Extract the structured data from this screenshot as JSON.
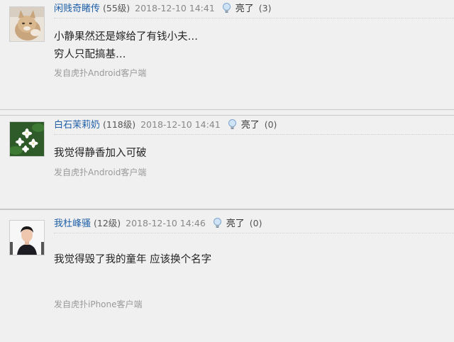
{
  "posts": [
    {
      "username": "闲贱奇睹传",
      "level": "(55级)",
      "time": "2018-12-10 14:41",
      "light_label": "亮了",
      "light_count": "(3)",
      "content_lines": [
        "小静果然还是嫁给了有钱小夫…",
        "穷人只配搞基…"
      ],
      "source": "发自虎扑Android客户端",
      "avatar_icon": "cat-avatar"
    },
    {
      "username": "白石茉莉奶",
      "level": "(118级)",
      "time": "2018-12-10 14:41",
      "light_label": "亮了",
      "light_count": "(0)",
      "content_lines": [
        "我觉得静香加入可破"
      ],
      "source": "发自虎扑Android客户端",
      "avatar_icon": "jasmine-flower-avatar"
    },
    {
      "username": "我杜峰骚",
      "level": "(12级)",
      "time": "2018-12-10 14:46",
      "light_label": "亮了",
      "light_count": "(0)",
      "content_lines": [
        "我觉得毁了我的童年 应该换个名字"
      ],
      "source": "发自虎扑iPhone客户端",
      "avatar_icon": "person-photo-avatar"
    }
  ]
}
